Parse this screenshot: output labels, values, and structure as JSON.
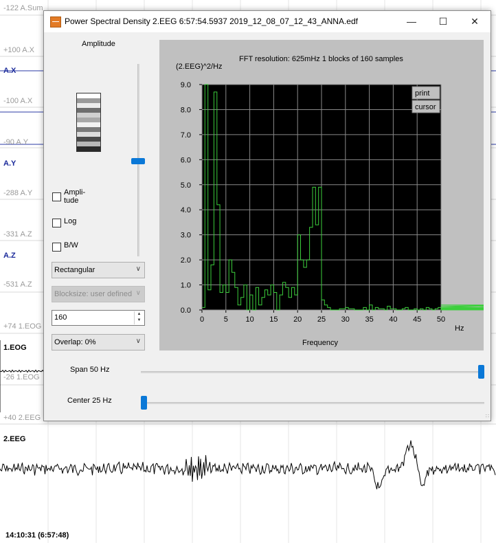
{
  "background": {
    "channel_labels": [
      {
        "text": "-122 A.Sum",
        "kind": "tick"
      },
      {
        "text": "+100 A.X",
        "kind": "tick"
      },
      {
        "text": "A.X",
        "kind": "chan"
      },
      {
        "text": "-100 A.X",
        "kind": "tick"
      },
      {
        "text": "-90 A.Y",
        "kind": "tick"
      },
      {
        "text": "A.Y",
        "kind": "chan"
      },
      {
        "text": "-288 A.Y",
        "kind": "tick"
      },
      {
        "text": "-331 A.Z",
        "kind": "tick"
      },
      {
        "text": "A.Z",
        "kind": "chan"
      },
      {
        "text": "-531 A.Z",
        "kind": "tick"
      },
      {
        "text": "+74 1.EOG",
        "kind": "tick"
      },
      {
        "text": "1.EOG",
        "kind": "chan"
      },
      {
        "text": "-26 1.EOG",
        "kind": "tick"
      },
      {
        "text": "+40 2.EEG",
        "kind": "tick"
      },
      {
        "text": "2.EEG",
        "kind": "chan"
      }
    ],
    "timestamp": "14:10:31 (6:57:48)"
  },
  "dialog": {
    "title": "Power Spectral Density    2.EEG    6:57:54.5937    2019_12_08_07_12_43_ANNA.edf",
    "minimize": "—",
    "maximize": "☐",
    "close": "✕",
    "amplitude_label": "Amplitude",
    "colorscale": [
      "#ffffff",
      "#9a9a9a",
      "#ececec",
      "#6e6e6e",
      "#d0d0d0",
      "#a8a8a8",
      "#f2f2f2",
      "#7a7a7a",
      "#dcdcdc",
      "#4a4a4a",
      "#b8b8b8",
      "#2a2a2a"
    ],
    "amplitude_slider_value": 0.48,
    "checkboxes": [
      {
        "label_line1": "Ampli-",
        "label_line2": "tude",
        "checked": false
      },
      {
        "label_line1": "Log",
        "label_line2": "",
        "checked": false
      },
      {
        "label_line1": "B/W",
        "label_line2": "",
        "checked": false
      }
    ],
    "window_select": "Rectangular",
    "blocksize_select": "Blocksize: user defined",
    "blocksize_value": "160",
    "overlap_select": "Overlap: 0%",
    "span_label": "Span 50 Hz",
    "span_value": 1.0,
    "center_label": "Center 25 Hz",
    "center_value": 0.0
  },
  "chart_data": {
    "type": "line",
    "title": "FFT resolution: 625mHz   1 blocks of 160 samples",
    "ylabel": "(2.EEG)^2/Hz",
    "xlabel": "Frequency",
    "xunit": "Hz",
    "xlim": [
      0,
      50
    ],
    "ylim": [
      0,
      9.0
    ],
    "xticks": [
      "0",
      "5",
      "10",
      "15",
      "20",
      "25",
      "30",
      "35",
      "40",
      "45",
      "50"
    ],
    "yticks": [
      "0.0",
      "1.0",
      "2.0",
      "3.0",
      "4.0",
      "5.0",
      "6.0",
      "7.0",
      "8.0",
      "9.0"
    ],
    "grid": true,
    "step": 0.625,
    "buttons": [
      "print",
      "cursor"
    ],
    "series": [
      {
        "color": "#3ccf3c",
        "values": [
          0.1,
          9.2,
          0.8,
          1.8,
          8.7,
          4.2,
          0.7,
          1.0,
          0.7,
          2.0,
          1.5,
          0.9,
          0.2,
          0.5,
          1.0,
          0.0,
          0.6,
          0.0,
          0.9,
          0.2,
          0.5,
          0.8,
          0.6,
          1.0,
          0.7,
          0.0,
          0.6,
          1.1,
          0.9,
          0.5,
          0.9,
          0.6,
          3.0,
          2.0,
          1.7,
          2.0,
          3.3,
          4.9,
          3.4,
          4.9,
          0.4,
          0.2,
          0.1,
          0.0,
          0.0,
          0.0,
          0.05,
          0.05,
          0.1,
          0.05,
          0.05,
          0.0,
          0.0,
          0.0,
          0.1,
          0.0,
          0.2,
          0.0,
          0.1,
          0.05,
          0.05,
          0.0,
          0.15,
          0.05,
          0.05,
          0.0,
          0.0,
          0.05,
          0.1,
          0.0,
          0.0,
          0.05,
          0.0,
          0.05,
          0.0,
          0.1,
          0.05,
          0.0,
          0.05,
          0.1,
          0.0,
          0.05,
          0.1,
          0.0,
          0.0,
          0.05,
          0.0,
          0.1,
          0.0,
          0.0,
          0.1,
          0.0,
          0.0,
          0.05,
          0.0,
          0.0,
          0.05,
          0.1,
          0.0,
          0.15,
          0.05,
          0.0,
          0.05,
          0.0,
          0.0,
          0.05,
          0.0,
          0.0,
          0.1,
          0.0,
          0.05,
          0.1,
          0.0,
          0.0,
          0.05,
          0.0,
          0.15,
          0.0,
          0.0,
          0.05,
          0.0,
          0.0,
          0.1,
          0.0,
          0.0,
          0.05,
          0.05,
          0.0,
          0.0,
          0.1,
          0.05,
          0.0,
          0.05,
          0.0,
          0.0,
          0.05,
          0.1,
          0.0,
          0.0,
          0.05,
          0.0,
          0.05,
          0.0,
          0.1,
          0.0,
          0.0,
          0.05,
          0.0,
          0.0,
          0.05,
          0.0,
          0.1,
          0.0,
          0.05,
          0.0,
          0.05,
          0.0,
          0.15,
          0.2,
          0.1
        ]
      }
    ]
  }
}
